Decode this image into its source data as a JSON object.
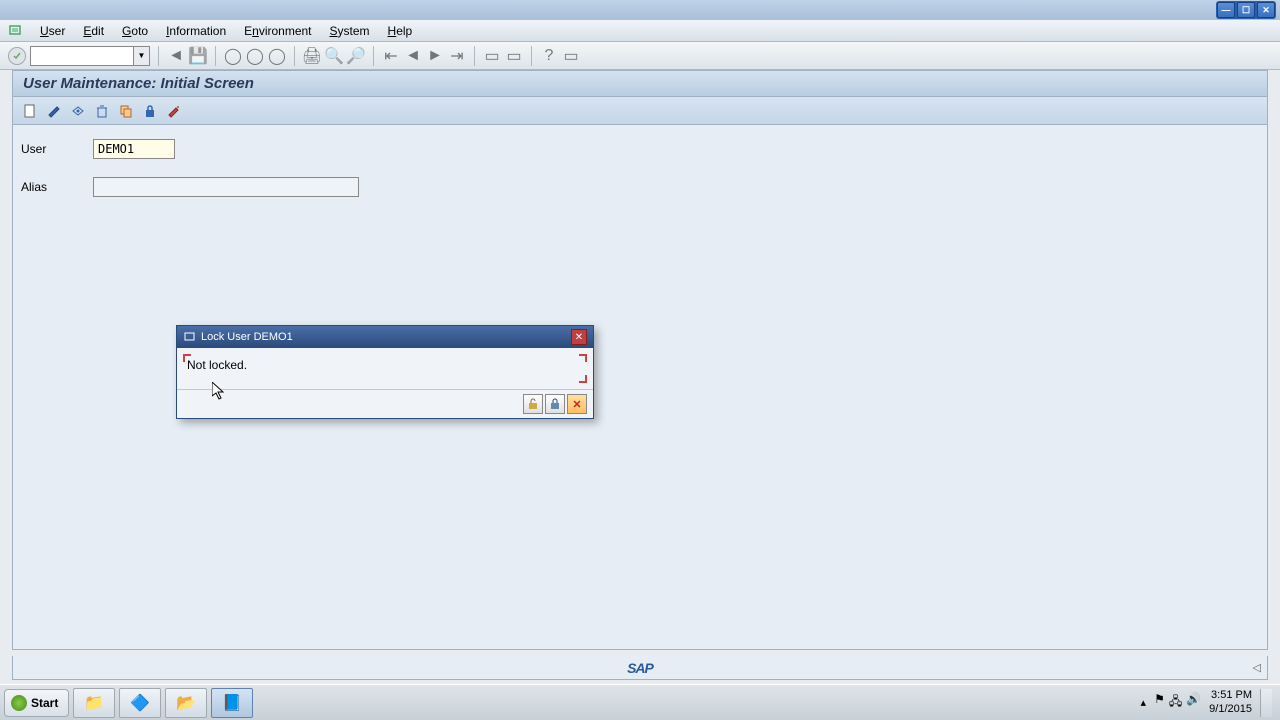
{
  "menubar": {
    "items": [
      {
        "label": "User",
        "key": "U"
      },
      {
        "label": "Edit",
        "key": "E"
      },
      {
        "label": "Goto",
        "key": "G"
      },
      {
        "label": "Information",
        "key": "I"
      },
      {
        "label": "Environment",
        "key": "n"
      },
      {
        "label": "System",
        "key": "S"
      },
      {
        "label": "Help",
        "key": "H"
      }
    ]
  },
  "page_title": "User Maintenance: Initial Screen",
  "form": {
    "user_label": "User",
    "user_value": "DEMO1",
    "alias_label": "Alias",
    "alias_value": ""
  },
  "dialog": {
    "title": "Lock User DEMO1",
    "message": "Not locked."
  },
  "statusbar": {
    "logo": "SAP"
  },
  "taskbar": {
    "start": "Start",
    "time": "3:51 PM",
    "date": "9/1/2015"
  }
}
